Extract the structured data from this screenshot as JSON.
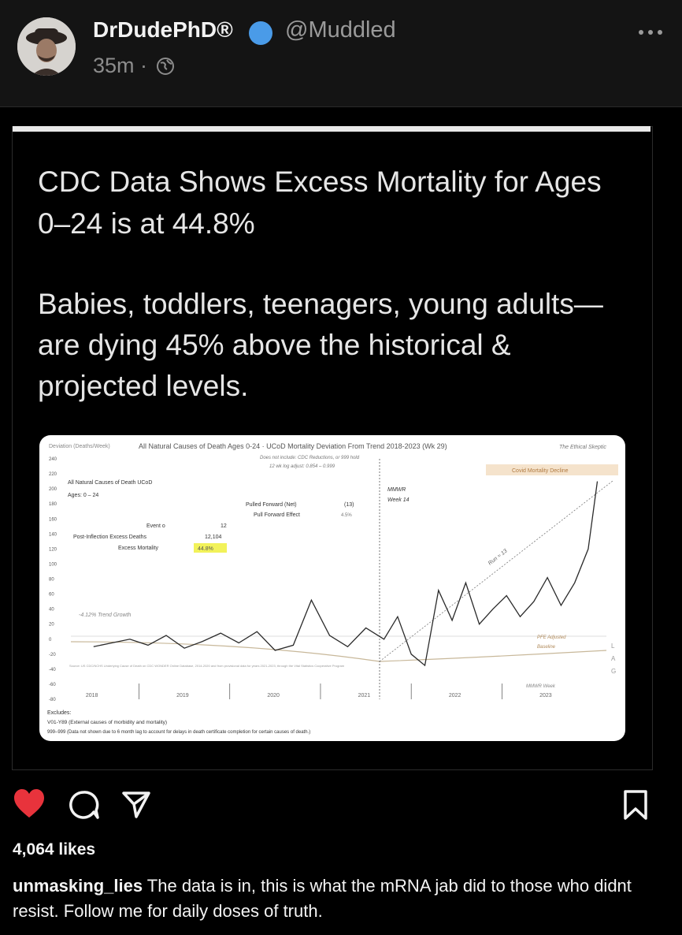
{
  "header": {
    "username": "DrDudePhD®",
    "handle": "@Muddled",
    "time": "35m ·",
    "icons": {
      "verified": "verified-badge-icon",
      "globe": "globe-icon",
      "more": "more-icon"
    },
    "accent_color": "#4a9be8"
  },
  "post": {
    "headline": "CDC Data Shows Excess Mortality for Ages 0–24 is at 44.8%",
    "subheadline": "Babies, toddlers, teenagers, young adults—are dying 45% above the historical & projected levels."
  },
  "chart": {
    "title": "All Natural Causes of Death Ages 0-24 · UCoD Mortality Deviation From Trend 2018-2023 (Wk 29)",
    "note1": "Does not include: CDC Reductions, or 999 hold",
    "note2": "12 wk log adjust: 0.854 – 0.999",
    "watermark": "The Ethical Skeptic",
    "ylabel": "Deviation (Deaths/Week)",
    "covid_decline": "Covid Mortality Decline",
    "label_causes": "All Natural Causes of Death UCoD",
    "label_ages": "Ages: 0 – 24",
    "pulled_forward_net": "Pulled Forward (Net)",
    "pull_forward_effect": "Pull Forward Effect",
    "pulled_value": "(13)",
    "pull_pct": "4.5%",
    "event_label": "Event o",
    "event_value": "12",
    "post_inflection_label": "Post-Inflection Excess Deaths",
    "post_inflection_value": "12,104",
    "excess_label": "Excess Mortality",
    "excess_value": "44.8%",
    "mmwr": "MMWR",
    "week14": "Week 14",
    "trend_growth": "-4.12% Trend Growth",
    "run_label": "Run ≈ 13",
    "pfe": "PFE Adjusted",
    "baseline": "Baseline",
    "source": "Source: US CDC/NCHS Underlying Cause of Death on CDC WONDER Online Database, 2014-2020 and from provisional data for years 2021-2023, through the Vital Statistics Cooperative Program",
    "mmwr_week": "MMWR Week",
    "excludes_title": "Excludes:",
    "excludes_1": "V01-Y89 (External causes of morbidity and mortality)",
    "excludes_2": "999–999 (Data not shown due to 6 month lag to account for delays in death certificate completion for certain causes of death.)",
    "side_l": "L",
    "side_a": "A",
    "side_g": "G"
  },
  "chart_data": {
    "type": "line",
    "title": "All Natural Causes of Death Ages 0-24 · UCoD Mortality Deviation From Trend 2018-2023 (Wk 29)",
    "ylabel": "Deviation (Deaths/Week)",
    "ylim": [
      -80,
      240
    ],
    "yticks": [
      240,
      220,
      200,
      180,
      160,
      140,
      120,
      100,
      80,
      60,
      40,
      20,
      0,
      -20,
      -40,
      -60,
      -80
    ],
    "xticks": [
      "2018",
      "2019",
      "2020",
      "2021",
      "2022",
      "2023"
    ],
    "series": [
      {
        "x": [
          2018.0,
          2018.2,
          2018.4,
          2018.6,
          2018.8,
          2019.0,
          2019.2,
          2019.4,
          2019.6,
          2019.8,
          2020.0,
          2020.2,
          2020.4,
          2020.6,
          2020.8,
          2021.0,
          2021.2,
          2021.35,
          2021.5,
          2021.65,
          2021.8,
          2021.95,
          2022.1,
          2022.25,
          2022.4,
          2022.55,
          2022.7,
          2022.85,
          2023.0,
          2023.15,
          2023.3,
          2023.45,
          2023.55
        ],
        "values": [
          -10,
          -5,
          0,
          -8,
          5,
          -12,
          -3,
          8,
          -5,
          10,
          -15,
          -8,
          52,
          5,
          -10,
          15,
          0,
          30,
          -20,
          -35,
          65,
          25,
          75,
          20,
          40,
          58,
          30,
          50,
          82,
          45,
          75,
          120,
          210
        ]
      }
    ],
    "annotations": [
      "Event o 12",
      "Post-Inflection Excess Deaths 12,104",
      "Excess Mortality 44.8%",
      "Pulled Forward (Net) (13)",
      "Pull Forward Effect 4.5%"
    ]
  },
  "actions": {
    "icons": [
      "heart-icon",
      "comment-icon",
      "share-icon",
      "bookmark-icon"
    ],
    "heart_color": "#e8333c"
  },
  "likes": "4,064 likes",
  "caption": {
    "user": "unmasking_lies",
    "text": "The data is in, this is what the mRNA jab did to those who didnt resist. Follow me for daily doses of truth."
  }
}
